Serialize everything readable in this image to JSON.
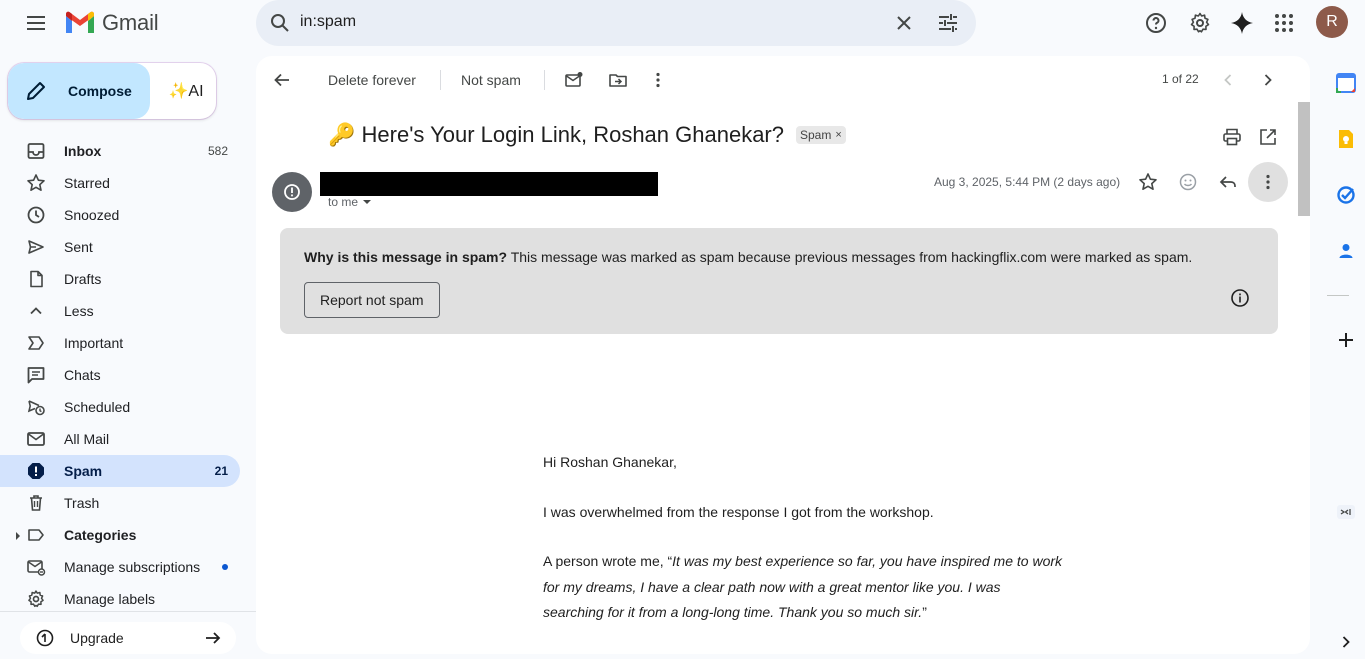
{
  "header": {
    "app_name": "Gmail",
    "search_value": "in:spam",
    "avatar_letter": "R"
  },
  "compose": {
    "label": "Compose",
    "ai_label": "✨AI"
  },
  "sidebar": {
    "items": [
      {
        "label": "Inbox",
        "count": "582"
      },
      {
        "label": "Starred",
        "count": ""
      },
      {
        "label": "Snoozed",
        "count": ""
      },
      {
        "label": "Sent",
        "count": ""
      },
      {
        "label": "Drafts",
        "count": ""
      },
      {
        "label": "Less",
        "count": ""
      },
      {
        "label": "Important",
        "count": ""
      },
      {
        "label": "Chats",
        "count": ""
      },
      {
        "label": "Scheduled",
        "count": ""
      },
      {
        "label": "All Mail",
        "count": ""
      },
      {
        "label": "Spam",
        "count": "21"
      },
      {
        "label": "Trash",
        "count": ""
      },
      {
        "label": "Categories",
        "count": ""
      },
      {
        "label": "Manage subscriptions",
        "count": ""
      },
      {
        "label": "Manage labels",
        "count": ""
      }
    ],
    "upgrade_label": "Upgrade"
  },
  "toolbar": {
    "delete_forever": "Delete forever",
    "not_spam": "Not spam",
    "pager": "1 of 22"
  },
  "message": {
    "subject": "🔑 Here's Your Login Link, Roshan Ghanekar?",
    "label_chip": "Spam",
    "to": "to me",
    "date": "Aug 3, 2025, 5:44 PM (2 days ago)",
    "spam_notice": {
      "question": "Why is this message in spam?",
      "explanation": "This message was marked as spam because previous messages from hackingflix.com were marked as spam.",
      "button": "Report not spam"
    },
    "body": {
      "greeting": "Hi Roshan Ghanekar,",
      "line1": "I was overwhelmed from the response I got from the workshop.",
      "quote_intro": "A person wrote me, “",
      "quote_line1": "It was my best experience so far, you have inspired me to work",
      "quote_line2": "for my dreams, I have a clear path now with a great mentor like you. I was",
      "quote_line3": "searching for it from a long-long time. Thank you so much sir.",
      "quote_close": "”"
    }
  },
  "colors": {
    "active_nav": "#d3e3fd",
    "compose_bg": "#c2e7ff",
    "search_bg": "#e9eef6",
    "spam_notice_bg": "#e0e0e0",
    "page_bg": "#f8fafd"
  }
}
